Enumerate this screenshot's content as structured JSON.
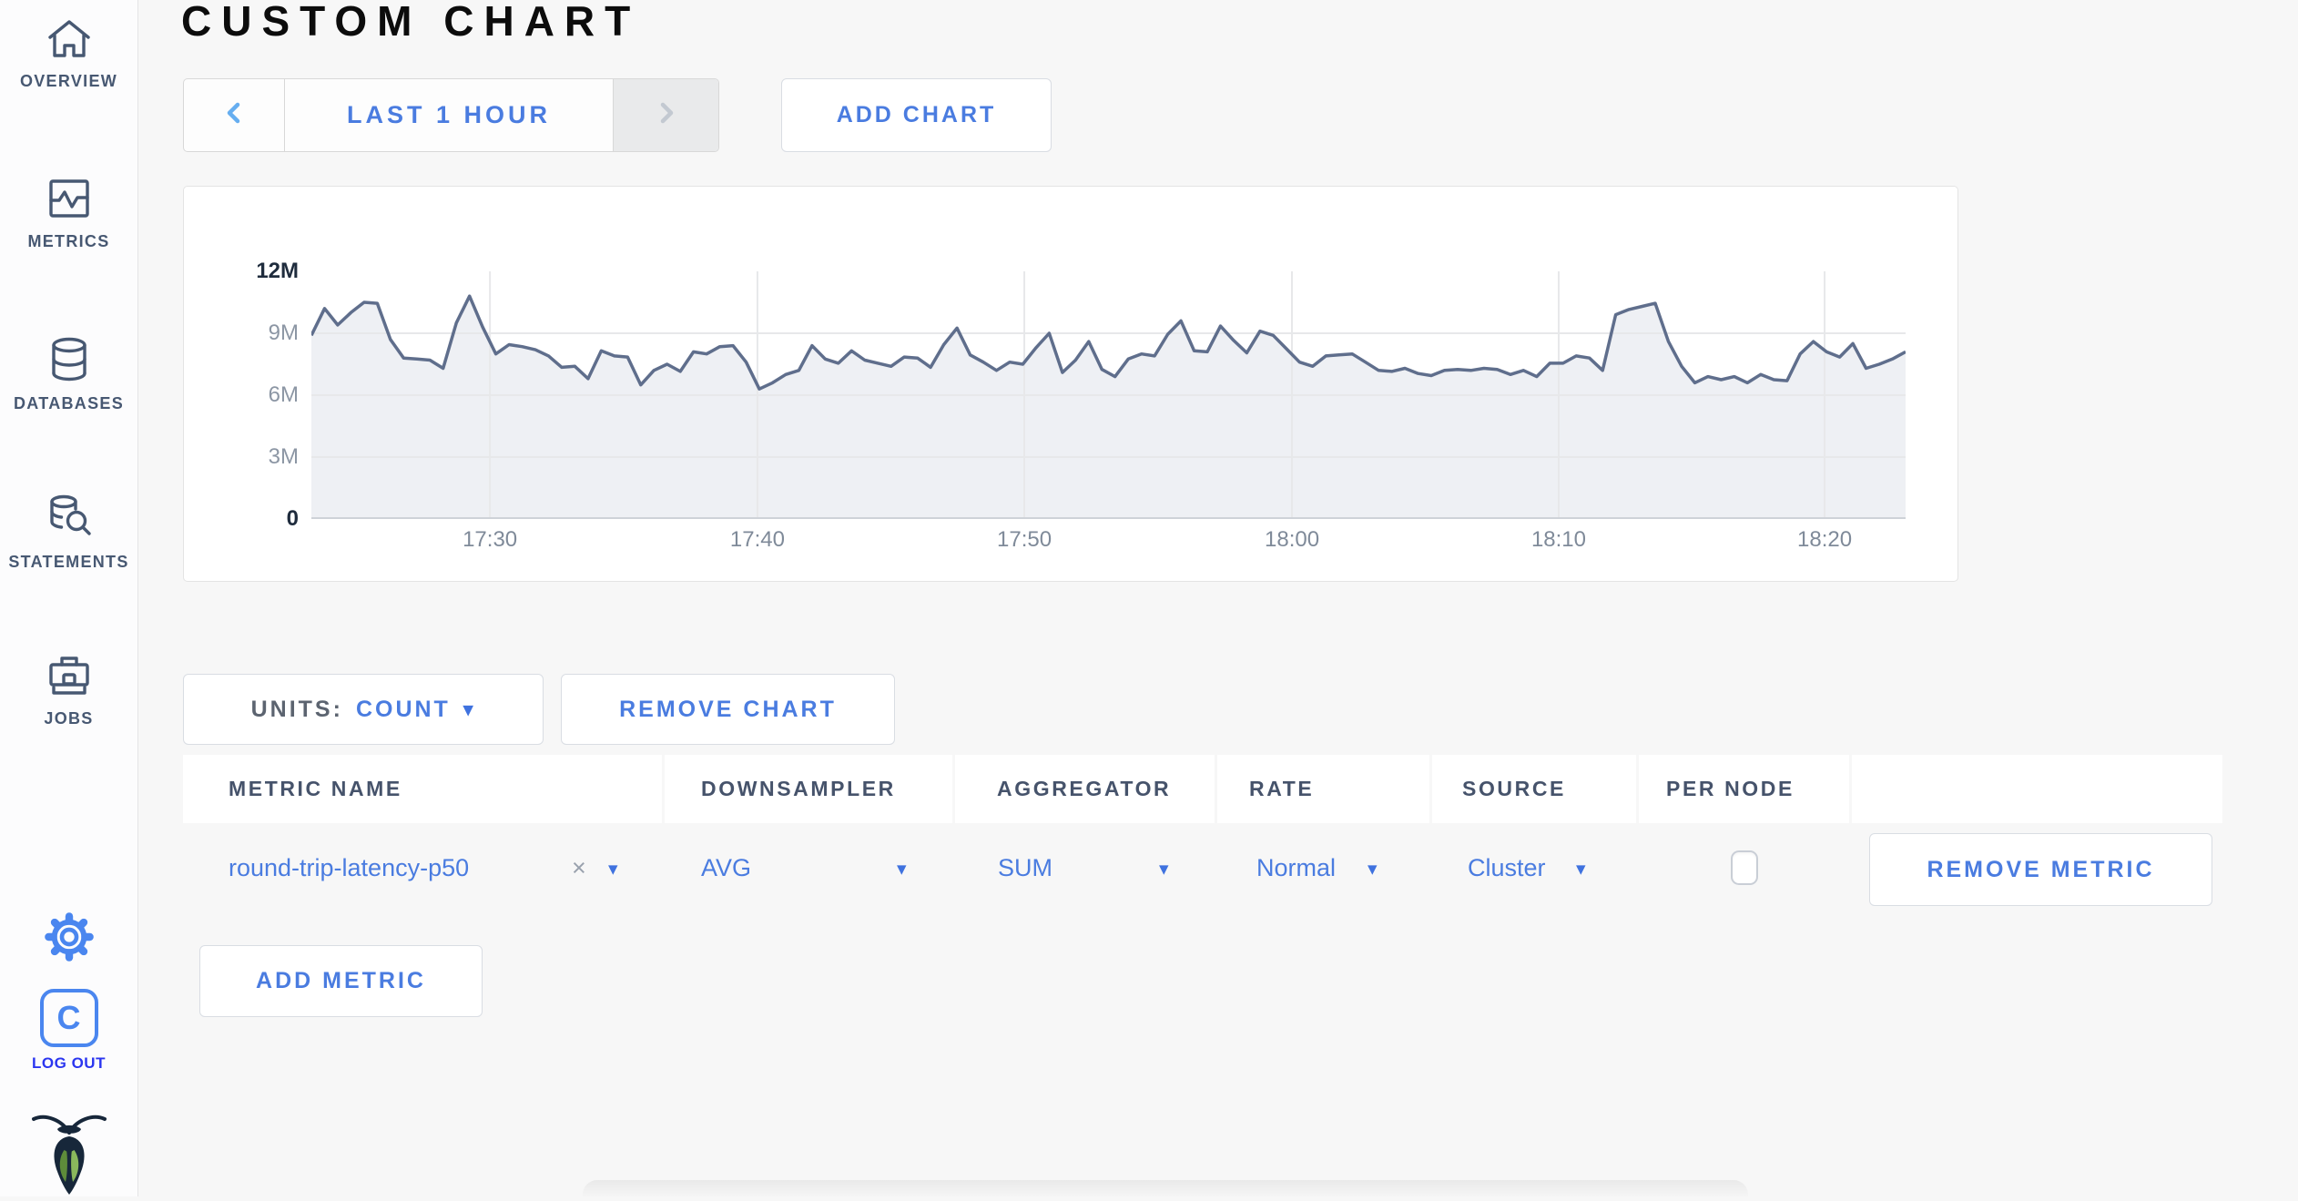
{
  "page": {
    "title": "CUSTOM CHART"
  },
  "sidebar": {
    "items": [
      {
        "label": "OVERVIEW",
        "icon": "home-icon"
      },
      {
        "label": "METRICS",
        "icon": "metrics-icon"
      },
      {
        "label": "DATABASES",
        "icon": "database-icon"
      },
      {
        "label": "STATEMENTS",
        "icon": "statements-icon"
      },
      {
        "label": "JOBS",
        "icon": "briefcase-icon"
      }
    ],
    "logout": {
      "letter": "C",
      "label": "LOG OUT"
    }
  },
  "toolbar": {
    "time_range_label": "LAST 1 HOUR",
    "add_chart_label": "ADD CHART"
  },
  "chart_controls": {
    "units_label": "UNITS:",
    "units_value": "COUNT",
    "remove_chart_label": "REMOVE CHART",
    "add_metric_label": "ADD METRIC"
  },
  "metric_table": {
    "headers": [
      "METRIC NAME",
      "DOWNSAMPLER",
      "AGGREGATOR",
      "RATE",
      "SOURCE",
      "PER NODE",
      ""
    ],
    "rows": [
      {
        "metric_name": "round-trip-latency-p50",
        "clear": "×",
        "downsampler": "AVG",
        "aggregator": "SUM",
        "rate": "Normal",
        "source": "Cluster",
        "per_node_checked": false,
        "remove_label": "REMOVE METRIC"
      }
    ]
  },
  "ui": {
    "caret": "▾"
  },
  "colors": {
    "accent_blue": "#4a7ce0",
    "icon_blue": "#4a86ef",
    "logout_blue": "#2b36f0",
    "sidebar_slate": "#475872",
    "chart_line": "#5f6e8c",
    "chart_fill": "#eef0f4",
    "grid_line": "#e7e8ea",
    "axis_text_gray": "#8c96a4",
    "axis_text_dark": "#1f2c3d"
  },
  "chart_data": {
    "type": "area",
    "title": "",
    "xlabel": "",
    "ylabel": "count",
    "series_name": "round-trip-latency-p50",
    "units": "millions",
    "ylim": [
      0,
      12
    ],
    "grid": true,
    "legend": "none",
    "x_ticks": [
      {
        "label": "17:30",
        "frac": 0.112
      },
      {
        "label": "17:40",
        "frac": 0.2798
      },
      {
        "label": "17:50",
        "frac": 0.4472
      },
      {
        "label": "18:00",
        "frac": 0.6151
      },
      {
        "label": "18:10",
        "frac": 0.7824
      },
      {
        "label": "18:20",
        "frac": 0.9492
      }
    ],
    "y_ticks": [
      {
        "label": "0",
        "value": 0,
        "dark": true
      },
      {
        "label": "3M",
        "value": 3,
        "dark": false
      },
      {
        "label": "6M",
        "value": 6,
        "dark": false
      },
      {
        "label": "9M",
        "value": 9,
        "dark": false
      },
      {
        "label": "12M",
        "value": 12,
        "dark": true
      }
    ],
    "sample_interval_seconds": 30,
    "time_span": "17:23 - 18:23",
    "values_millions": [
      8.9,
      10.2,
      9.4,
      10.0,
      10.5,
      10.45,
      8.7,
      7.8,
      7.75,
      7.7,
      7.3,
      9.5,
      10.8,
      9.3,
      8.0,
      8.45,
      8.35,
      8.2,
      7.9,
      7.35,
      7.4,
      6.8,
      8.15,
      7.9,
      7.85,
      6.5,
      7.2,
      7.5,
      7.15,
      8.1,
      8.0,
      8.35,
      8.4,
      7.6,
      6.3,
      6.6,
      7.0,
      7.2,
      8.4,
      7.75,
      7.55,
      8.15,
      7.7,
      7.55,
      7.4,
      7.85,
      7.8,
      7.35,
      8.45,
      9.25,
      7.95,
      7.6,
      7.2,
      7.6,
      7.5,
      8.3,
      9.0,
      7.1,
      7.7,
      8.6,
      7.25,
      6.9,
      7.75,
      8.0,
      7.9,
      8.95,
      9.6,
      8.15,
      8.1,
      9.35,
      8.65,
      8.05,
      9.1,
      8.9,
      8.25,
      7.6,
      7.4,
      7.9,
      7.95,
      8.0,
      7.6,
      7.2,
      7.15,
      7.3,
      7.05,
      6.95,
      7.2,
      7.25,
      7.2,
      7.3,
      7.25,
      7.0,
      7.2,
      6.9,
      7.55,
      7.55,
      7.9,
      7.8,
      7.2,
      9.9,
      10.15,
      10.3,
      10.45,
      8.6,
      7.4,
      6.6,
      6.9,
      6.75,
      6.9,
      6.6,
      7.0,
      6.75,
      6.7,
      8.0,
      8.6,
      8.1,
      7.85,
      8.5,
      7.3,
      7.5,
      7.75,
      8.1
    ]
  }
}
